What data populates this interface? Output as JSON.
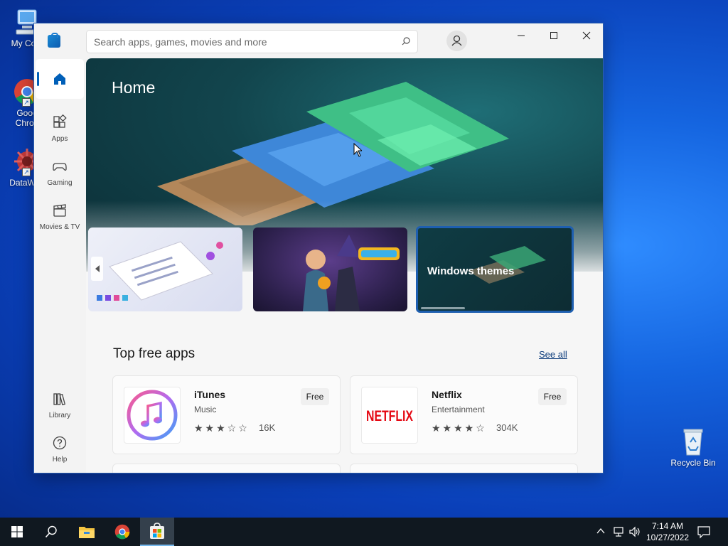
{
  "desktop": {
    "icons": [
      {
        "label": "My Com"
      },
      {
        "label": "Goog\nChron"
      },
      {
        "label": "DataWag"
      },
      {
        "label": "Recycle Bin"
      }
    ]
  },
  "window": {
    "search": {
      "placeholder": "Search apps, games, movies and more"
    }
  },
  "sidebar": {
    "items": [
      {
        "label": "Home",
        "icon": "home-icon"
      },
      {
        "label": "Apps",
        "icon": "apps-icon"
      },
      {
        "label": "Gaming",
        "icon": "gamepad-icon"
      },
      {
        "label": "Movies & TV",
        "icon": "clapperboard-icon"
      },
      {
        "label": "Library",
        "icon": "library-icon"
      },
      {
        "label": "Help",
        "icon": "help-icon"
      }
    ]
  },
  "hero": {
    "title": "Home",
    "cards": [
      {
        "label": ""
      },
      {
        "label": ""
      },
      {
        "label": "Windows themes"
      }
    ]
  },
  "top_free": {
    "title": "Top free apps",
    "see_all": "See all",
    "apps": [
      {
        "name": "iTunes",
        "category": "Music",
        "price": "Free",
        "rating": 3,
        "reviews": "16K"
      },
      {
        "name": "Netflix",
        "category": "Entertainment",
        "price": "Free",
        "rating": 4,
        "reviews": "304K"
      }
    ]
  },
  "taskbar": {
    "time": "7:14 AM",
    "date": "10/27/2022"
  },
  "colors": {
    "accent": "#005fb8",
    "netflix_red": "#e50914"
  }
}
